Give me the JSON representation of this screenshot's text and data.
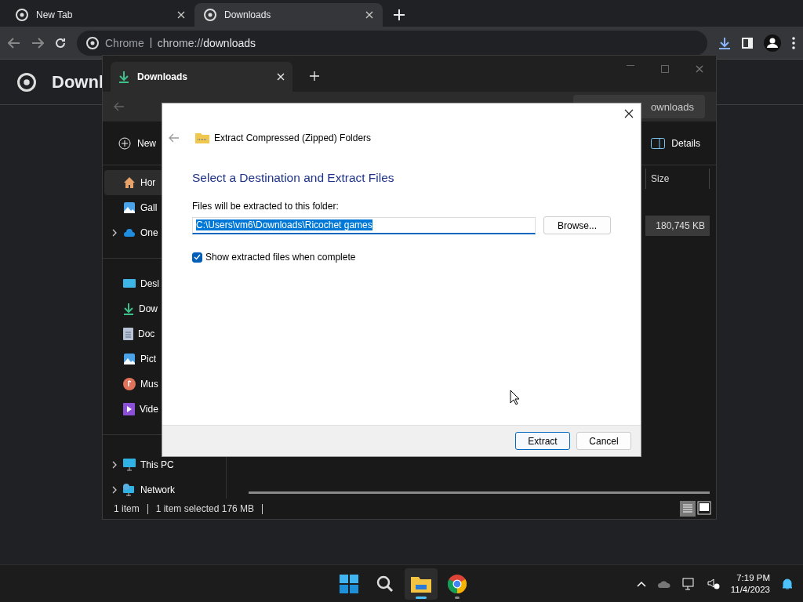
{
  "browser": {
    "tabs": [
      {
        "label": "New Tab",
        "selected": false
      },
      {
        "label": "Downloads",
        "selected": true
      }
    ],
    "address": {
      "site": "Chrome",
      "url": "chrome://**downloads**"
    },
    "page_title": "Downl"
  },
  "explorer": {
    "tab": "Downloads",
    "search_text": "ownloads",
    "new_label": "New",
    "details_label": "Details",
    "column": "Size",
    "row": {
      "size": "180,745 KB",
      "selected": true
    },
    "sidebar": [
      [
        {
          "label": "Hor",
          "kind": "home",
          "selected": true,
          "expandable": false
        },
        {
          "label": "Gall",
          "kind": "gallery",
          "selected": false,
          "expandable": false
        },
        {
          "label": "One",
          "kind": "cloud",
          "selected": false,
          "expandable": true
        }
      ],
      [
        {
          "label": "Desl",
          "kind": "desktop",
          "selected": false,
          "expandable": false
        },
        {
          "label": "Dow",
          "kind": "download",
          "selected": false,
          "expandable": false
        },
        {
          "label": "Doc",
          "kind": "documents",
          "selected": false,
          "expandable": false
        },
        {
          "label": "Pict",
          "kind": "pictures",
          "selected": false,
          "expandable": false
        },
        {
          "label": "Mus",
          "kind": "music",
          "selected": false,
          "expandable": false
        },
        {
          "label": "Vide",
          "kind": "videos",
          "selected": false,
          "expandable": false
        }
      ],
      [
        {
          "label": "This PC",
          "kind": "pc",
          "selected": false,
          "expandable": true
        },
        {
          "label": "Network",
          "kind": "network",
          "selected": false,
          "expandable": true
        }
      ]
    ],
    "status": [
      "1 item",
      "1 item selected  176 MB"
    ]
  },
  "dialog": {
    "title": "Extract Compressed (Zipped) Folders",
    "heading": "Select a Destination and Extract Files",
    "folder_label": "Files will be extracted to this folder:",
    "path": "C:\\Users\\vm6\\Downloads\\Ricochet games",
    "path_selected": true,
    "browse": "Browse...",
    "checkbox": {
      "label": "Show extracted files when complete",
      "checked": true
    },
    "buttons": [
      {
        "label": "Extract",
        "default": true
      },
      {
        "label": "Cancel",
        "default": false
      }
    ]
  },
  "taskbar": {
    "apps": [
      {
        "kind": "start",
        "active": false
      },
      {
        "kind": "search",
        "active": false
      },
      {
        "kind": "explorer",
        "active": true
      },
      {
        "kind": "chrome",
        "active": false
      }
    ],
    "time": "7:19 PM",
    "date": "11/4/2023"
  }
}
